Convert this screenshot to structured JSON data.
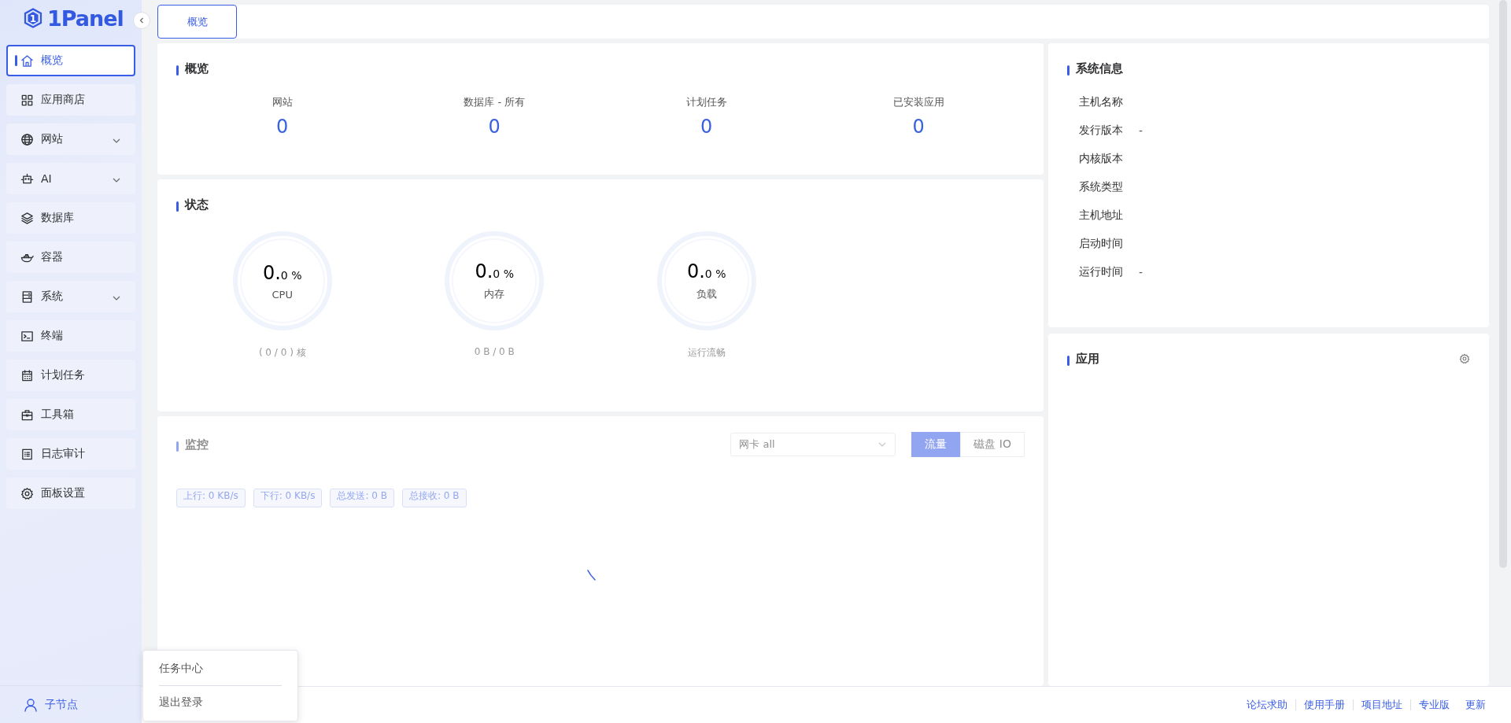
{
  "logo": {
    "mark": "1",
    "text": "1Panel"
  },
  "sidebar": {
    "items": [
      {
        "label": "概览",
        "selected": true,
        "expandable": false
      },
      {
        "label": "应用商店",
        "selected": false,
        "expandable": false
      },
      {
        "label": "网站",
        "selected": false,
        "expandable": true
      },
      {
        "label": "AI",
        "selected": false,
        "expandable": true
      },
      {
        "label": "数据库",
        "selected": false,
        "expandable": false
      },
      {
        "label": "容器",
        "selected": false,
        "expandable": false
      },
      {
        "label": "系统",
        "selected": false,
        "expandable": true
      },
      {
        "label": "终端",
        "selected": false,
        "expandable": false
      },
      {
        "label": "计划任务",
        "selected": false,
        "expandable": false
      },
      {
        "label": "工具箱",
        "selected": false,
        "expandable": false
      },
      {
        "label": "日志审计",
        "selected": false,
        "expandable": false
      },
      {
        "label": "面板设置",
        "selected": false,
        "expandable": false
      }
    ],
    "node": {
      "label": "子节点"
    }
  },
  "tabs": [
    {
      "label": "概览",
      "selected": true
    }
  ],
  "overview": {
    "title": "概览",
    "stats": [
      {
        "label": "网站",
        "value": "0"
      },
      {
        "label": "数据库 - 所有",
        "value": "0"
      },
      {
        "label": "计划任务",
        "value": "0"
      },
      {
        "label": "已安装应用",
        "value": "0"
      }
    ]
  },
  "status": {
    "title": "状态",
    "gauges": [
      {
        "value": "0.",
        "decimal": "0 %",
        "label": "CPU",
        "detail": "( 0 / 0 ) 核",
        "level": 0
      },
      {
        "value": "0.",
        "decimal": "0 %",
        "label": "内存",
        "detail": "0 B / 0 B",
        "level": 0
      },
      {
        "value": "0.",
        "decimal": "0 %",
        "label": "负载",
        "detail": "运行流畅",
        "level": 0
      }
    ]
  },
  "monitor": {
    "title": "监控",
    "loading": true,
    "nic": {
      "prefix": "网卡",
      "value": "all"
    },
    "modes": [
      {
        "label": "流量",
        "selected": true
      },
      {
        "label": "磁盘 IO",
        "selected": false
      }
    ],
    "tags": [
      "上行: 0 KB/s",
      "下行: 0 KB/s",
      "总发送: 0 B",
      "总接收: 0 B"
    ]
  },
  "system_info": {
    "title": "系统信息",
    "rows": [
      {
        "label": "主机名称"
      },
      {
        "label": "发行版本",
        "value": "-"
      },
      {
        "label": "内核版本"
      },
      {
        "label": "系统类型"
      },
      {
        "label": "主机地址"
      },
      {
        "label": "启动时间"
      },
      {
        "label": "运行时间",
        "value": "-"
      }
    ]
  },
  "apps": {
    "title": "应用"
  },
  "user_menu": {
    "items": [
      "任务中心",
      "退出登录"
    ]
  },
  "footer_links": [
    "论坛求助",
    "使用手册",
    "项目地址",
    "专业版",
    "更新"
  ]
}
